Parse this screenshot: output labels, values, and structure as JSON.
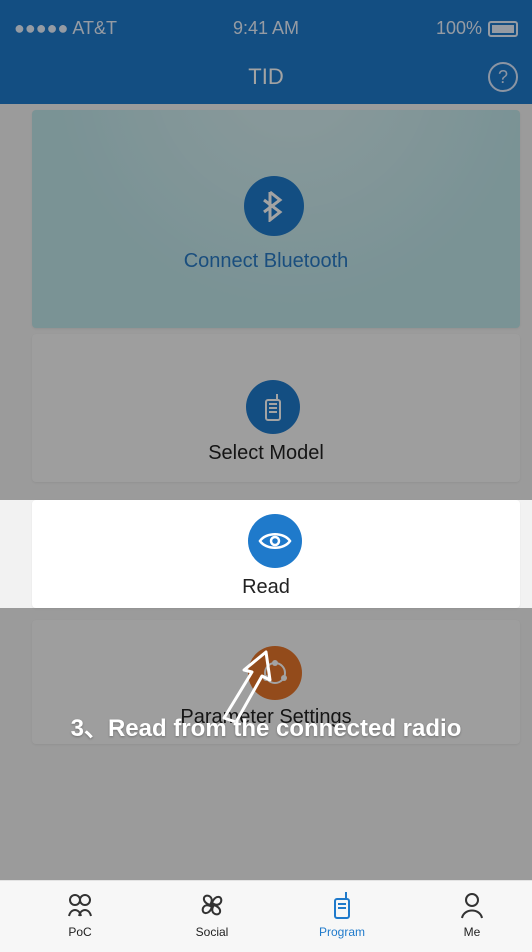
{
  "status": {
    "carrier": "●●●●● AT&T",
    "time": "9:41 AM",
    "battery": "100%"
  },
  "header": {
    "title": "TID"
  },
  "cards": {
    "bluetooth": "Connect Bluetooth",
    "select_model": "Select Model",
    "read": "Read",
    "params": "Parameter Settings"
  },
  "guide": {
    "text": "3、Read from the connected radio"
  },
  "tabs": [
    {
      "label": "PoC"
    },
    {
      "label": "Social"
    },
    {
      "label": "Program"
    },
    {
      "label": "Me"
    }
  ],
  "colors": {
    "accent": "#1f7acb",
    "orange": "#e7762b",
    "bt_bg": "#bfe6ea"
  }
}
